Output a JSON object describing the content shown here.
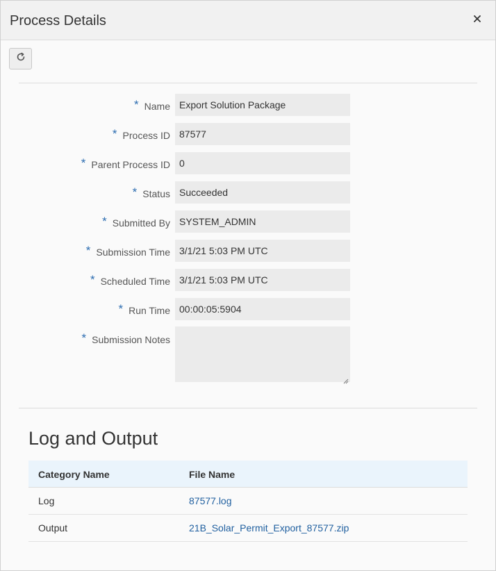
{
  "dialog": {
    "title": "Process Details",
    "close_icon": "close-icon",
    "refresh_icon": "refresh-icon"
  },
  "form": {
    "required_marker": "*",
    "fields": [
      {
        "label": "Name",
        "value": "Export Solution Package"
      },
      {
        "label": "Process ID",
        "value": "87577"
      },
      {
        "label": "Parent Process ID",
        "value": "0"
      },
      {
        "label": "Status",
        "value": "Succeeded"
      },
      {
        "label": "Submitted By",
        "value": "SYSTEM_ADMIN"
      },
      {
        "label": "Submission Time",
        "value": "3/1/21 5:03 PM UTC"
      },
      {
        "label": "Scheduled Time",
        "value": "3/1/21 5:03 PM UTC"
      },
      {
        "label": "Run Time",
        "value": "00:00:05:5904"
      }
    ],
    "notes": {
      "label": "Submission Notes",
      "value": ""
    }
  },
  "log_output": {
    "title": "Log and Output",
    "columns": [
      "Category Name",
      "File Name"
    ],
    "rows": [
      {
        "category": "Log",
        "file": "87577.log"
      },
      {
        "category": "Output",
        "file": "21B_Solar_Permit_Export_87577.zip"
      }
    ]
  },
  "colors": {
    "required_marker": "#2b6cb0",
    "link": "#1f5f9f",
    "table_header_bg": "#eaf4fc",
    "field_bg": "#ebebeb"
  }
}
